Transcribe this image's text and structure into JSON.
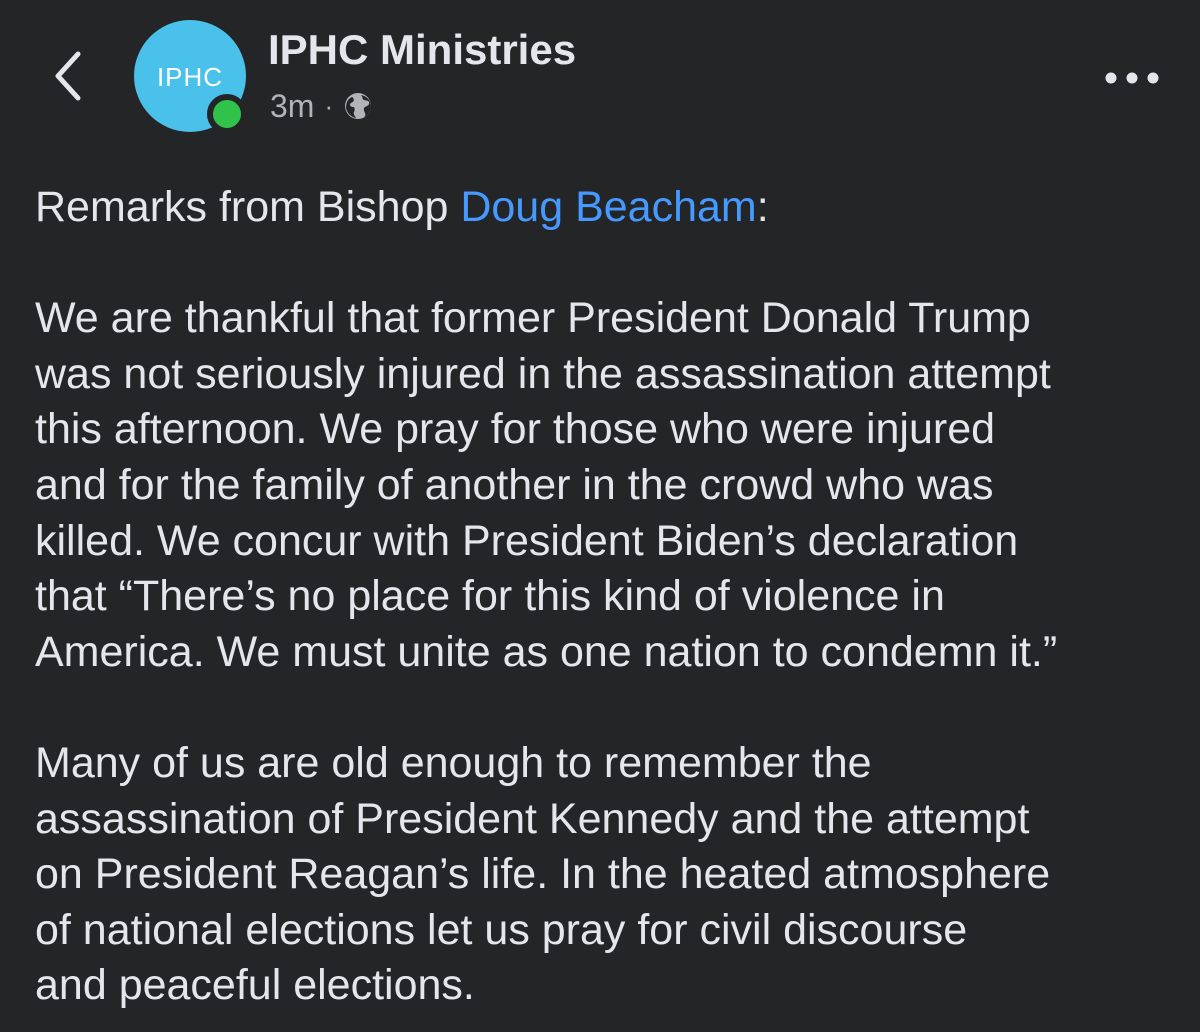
{
  "post_header": {
    "avatar_text": "IPHC",
    "page_name": "IPHC Ministries",
    "timestamp": "3m",
    "separator": "·",
    "privacy_icon": "globe-icon",
    "back_icon": "chevron-left-icon",
    "more_icon": "more-horizontal-icon"
  },
  "post": {
    "intro_prefix": "Remarks from Bishop ",
    "mention": "Doug Beacham",
    "intro_suffix": ":",
    "paragraph_2": [
      "We are thankful that former President Donald Trump",
      "was not seriously injured in the assassination attempt",
      "this afternoon. We pray for those who were injured",
      "and for the family of another in the crowd who was",
      "killed. We concur with President Biden’s declaration",
      "that “There’s no place for this kind of violence in",
      "America. We must unite as one nation to condemn it.”"
    ],
    "paragraph_3": [
      "Many of us are old enough to remember the",
      "assassination of President Kennedy and the attempt",
      "on President Reagan’s life. In the heated atmosphere",
      "of national elections let us pray for civil discourse",
      "and peaceful elections."
    ]
  },
  "colors": {
    "background": "#242526",
    "text": "#e4e6eb",
    "secondary_text": "#b0b3b8",
    "mention": "#4599ff",
    "avatar": "#4ac1ea",
    "online": "#31c24c"
  }
}
